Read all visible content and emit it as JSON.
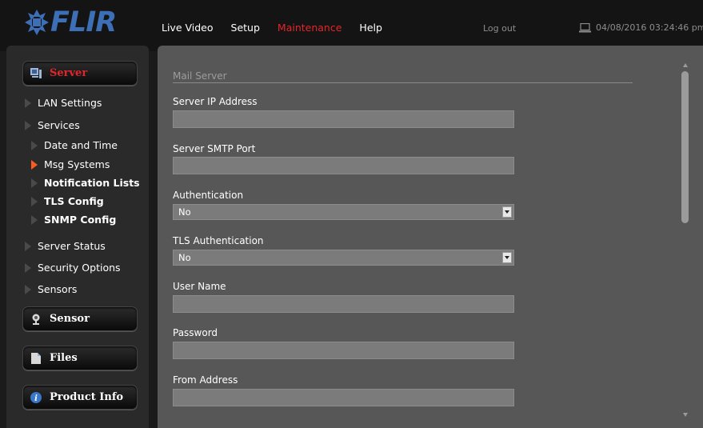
{
  "logo": {
    "text": "FLIR",
    "color": "#3d6fb7"
  },
  "nav": {
    "items": [
      "Live Video",
      "Setup",
      "Maintenance",
      "Help"
    ],
    "active": "Maintenance",
    "logout": "Log out",
    "datetime": "04/08/2016 03:24:46 pm"
  },
  "sidebar": {
    "server_label": "Server",
    "server_items": [
      {
        "label": "LAN Settings",
        "level": 0
      },
      {
        "label": "Services",
        "level": 0
      },
      {
        "label": "Date and Time",
        "level": 1
      },
      {
        "label": "Msg Systems",
        "level": 1,
        "selected": true
      },
      {
        "label": "Notification Lists",
        "level": 1
      },
      {
        "label": "TLS Config",
        "level": 1
      },
      {
        "label": "SNMP Config",
        "level": 1
      },
      {
        "label": "Server Status",
        "level": 0
      },
      {
        "label": "Security Options",
        "level": 0
      },
      {
        "label": "Sensors",
        "level": 0
      }
    ],
    "sensor_label": "Sensor",
    "files_label": "Files",
    "product_info_label": "Product Info"
  },
  "form": {
    "section_title": "Mail Server",
    "server_ip_label": "Server IP Address",
    "server_ip_value": "",
    "smtp_port_label": "Server SMTP Port",
    "smtp_port_value": "",
    "authentication_label": "Authentication",
    "authentication_value": "No",
    "tls_auth_label": "TLS Authentication",
    "tls_auth_value": "No",
    "username_label": "User Name",
    "username_value": "",
    "password_label": "Password",
    "password_value": "",
    "from_address_label": "From Address",
    "from_address_value": ""
  },
  "colors": {
    "accent_red": "#e3262b",
    "selected_arrow": "#ff5a1f"
  }
}
